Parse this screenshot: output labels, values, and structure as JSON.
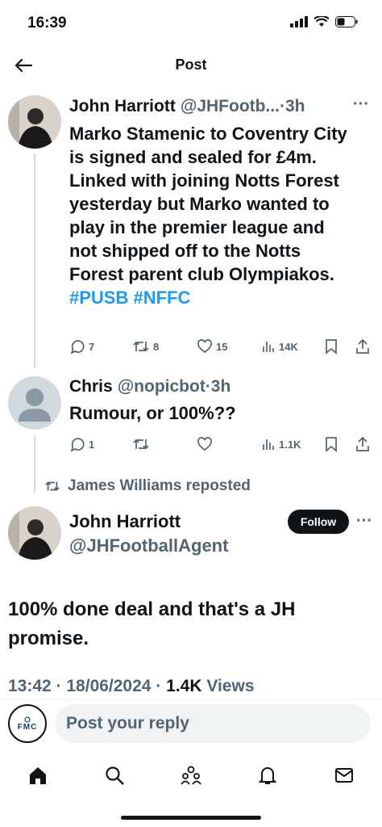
{
  "status_bar": {
    "time": "16:39"
  },
  "header": {
    "title": "Post"
  },
  "tweet1": {
    "name": "John Harriott",
    "handle_time": "@JHFootb...·3h",
    "text_plain": "Marko Stamenic to Coventry City is signed and sealed for £4m. Linked with joining Notts Forest yesterday but Marko wanted to play in the premier league and not shipped off to the Notts Forest parent club Olympiakos.",
    "hashtag1": "#PUSB",
    "hashtag2": "#NFFC",
    "replies": "7",
    "reposts": "8",
    "likes": "15",
    "views": "14K"
  },
  "tweet2": {
    "name": "Chris",
    "handle_time": "@nopicbot·3h",
    "text": "Rumour, or 100%??",
    "replies": "1",
    "views": "1.1K"
  },
  "repost_banner": {
    "text": "James Williams reposted"
  },
  "main_post": {
    "name": "John Harriott",
    "handle": "@JHFootballAgent",
    "follow_label": "Follow",
    "text": "100% done deal and that's a JH promise.",
    "meta_time": "13:42 · 18/06/2024 · ",
    "meta_views_count": "1.4K",
    "meta_views_label": "Views"
  },
  "reply": {
    "avatar_text": "FMC",
    "placeholder": "Post your reply"
  },
  "colors": {
    "accent": "#1d9bf0",
    "text": "#0f1419",
    "muted": "#536471"
  }
}
